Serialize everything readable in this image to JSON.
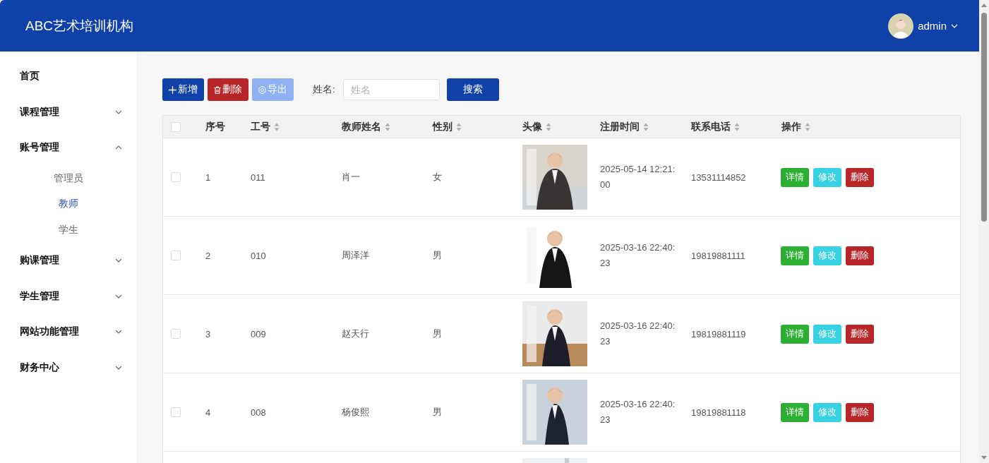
{
  "header": {
    "title": "ABC艺术培训机构",
    "user": "admin"
  },
  "sidebar": {
    "items": [
      {
        "label": "首页",
        "kind": "link"
      },
      {
        "label": "课程管理",
        "kind": "submenu",
        "expanded": false
      },
      {
        "label": "账号管理",
        "kind": "submenu",
        "expanded": true,
        "children": [
          {
            "label": "管理员",
            "selected": false
          },
          {
            "label": "教师",
            "selected": true
          },
          {
            "label": "学生",
            "selected": false
          }
        ]
      },
      {
        "label": "购课管理",
        "kind": "submenu",
        "expanded": false
      },
      {
        "label": "学生管理",
        "kind": "submenu",
        "expanded": false
      },
      {
        "label": "网站功能管理",
        "kind": "submenu",
        "expanded": false
      },
      {
        "label": "财务中心",
        "kind": "submenu",
        "expanded": false
      }
    ]
  },
  "toolbar": {
    "buttons": [
      {
        "label": "新增",
        "kind": "add",
        "disabled": false
      },
      {
        "label": "删除",
        "kind": "delete",
        "disabled": false
      },
      {
        "label": "导出",
        "kind": "export",
        "disabled": true
      }
    ],
    "search_label": "姓名:",
    "search": {
      "placeholder": "姓名"
    },
    "search_button": "搜索"
  },
  "table": {
    "header_checked": false,
    "columns": [
      {
        "label": "序号",
        "sortable": false
      },
      {
        "label": "工号",
        "sortable": true
      },
      {
        "label": "教师姓名",
        "sortable": true
      },
      {
        "label": "性别",
        "sortable": true
      },
      {
        "label": "头像",
        "sortable": true
      },
      {
        "label": "注册时间",
        "sortable": true
      },
      {
        "label": "联系电话",
        "sortable": true
      },
      {
        "label": "操作",
        "sortable": true
      }
    ],
    "rows": [
      {
        "checked": false,
        "index": "1",
        "id": "011",
        "name": "肖一",
        "gender": "女",
        "registered": "2025-05-14 12:21:00",
        "phone": "13531114852",
        "actions": [
          {
            "label": "详情",
            "kind": "detail"
          },
          {
            "label": "修改",
            "kind": "edit"
          },
          {
            "label": "删除",
            "kind": "delete"
          }
        ]
      },
      {
        "checked": false,
        "index": "2",
        "id": "010",
        "name": "周泽洋",
        "gender": "男",
        "registered": "2025-03-16 22:40:23",
        "phone": "19819881111",
        "actions": [
          {
            "label": "详情",
            "kind": "detail"
          },
          {
            "label": "修改",
            "kind": "edit"
          },
          {
            "label": "删除",
            "kind": "delete"
          }
        ]
      },
      {
        "checked": false,
        "index": "3",
        "id": "009",
        "name": "赵天行",
        "gender": "男",
        "registered": "2025-03-16 22:40:23",
        "phone": "19819881119",
        "actions": [
          {
            "label": "详情",
            "kind": "detail"
          },
          {
            "label": "修改",
            "kind": "edit"
          },
          {
            "label": "删除",
            "kind": "delete"
          }
        ]
      },
      {
        "checked": false,
        "index": "4",
        "id": "008",
        "name": "杨俊熙",
        "gender": "男",
        "registered": "2025-03-16 22:40:23",
        "phone": "19819881118",
        "actions": [
          {
            "label": "详情",
            "kind": "detail"
          },
          {
            "label": "修改",
            "kind": "edit"
          },
          {
            "label": "删除",
            "kind": "delete"
          }
        ]
      }
    ]
  }
}
